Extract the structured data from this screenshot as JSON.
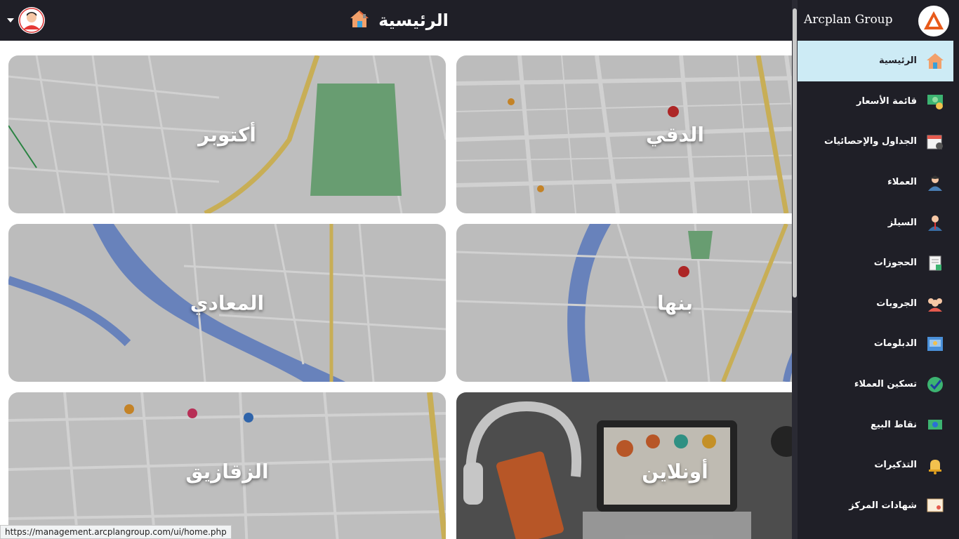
{
  "header": {
    "title": "الرئيسية",
    "home_icon": "home-icon",
    "user_icon": "user-avatar-icon"
  },
  "brand": {
    "name": "Arcplan Group",
    "logo_icon": "arcplan-logo-icon"
  },
  "cards": [
    {
      "label": "الدقي",
      "name": "card-dokki"
    },
    {
      "label": "أكتوبر",
      "name": "card-october"
    },
    {
      "label": "بنها",
      "name": "card-banha"
    },
    {
      "label": "المعادي",
      "name": "card-maadi"
    },
    {
      "label": "أونلاين",
      "name": "card-online"
    },
    {
      "label": "الزقازيق",
      "name": "card-zagazig"
    }
  ],
  "sidebar": {
    "items": [
      {
        "label": "الرئيسية",
        "icon": "home-icon",
        "active": true
      },
      {
        "label": "قائمة الأسعار",
        "icon": "price-list-icon"
      },
      {
        "label": "الجداول والإحصائيات",
        "icon": "calendar-stats-icon"
      },
      {
        "label": "العملاء",
        "icon": "clients-icon"
      },
      {
        "label": "السيلز",
        "icon": "sales-icon"
      },
      {
        "label": "الحجوزات",
        "icon": "bookings-icon"
      },
      {
        "label": "الجروبات",
        "icon": "groups-icon"
      },
      {
        "label": "الدبلومات",
        "icon": "diplomas-icon"
      },
      {
        "label": "تسكين العملاء",
        "icon": "client-placement-icon"
      },
      {
        "label": "نقاط البيع",
        "icon": "point-of-sale-icon"
      },
      {
        "label": "التذكيرات",
        "icon": "reminders-icon"
      },
      {
        "label": "شهادات المركز",
        "icon": "certificates-icon"
      }
    ]
  },
  "status_url": "https://management.arcplangroup.com/ui/home.php",
  "colors": {
    "dark": "#1f1f27",
    "active_bg": "#cdebf5"
  }
}
